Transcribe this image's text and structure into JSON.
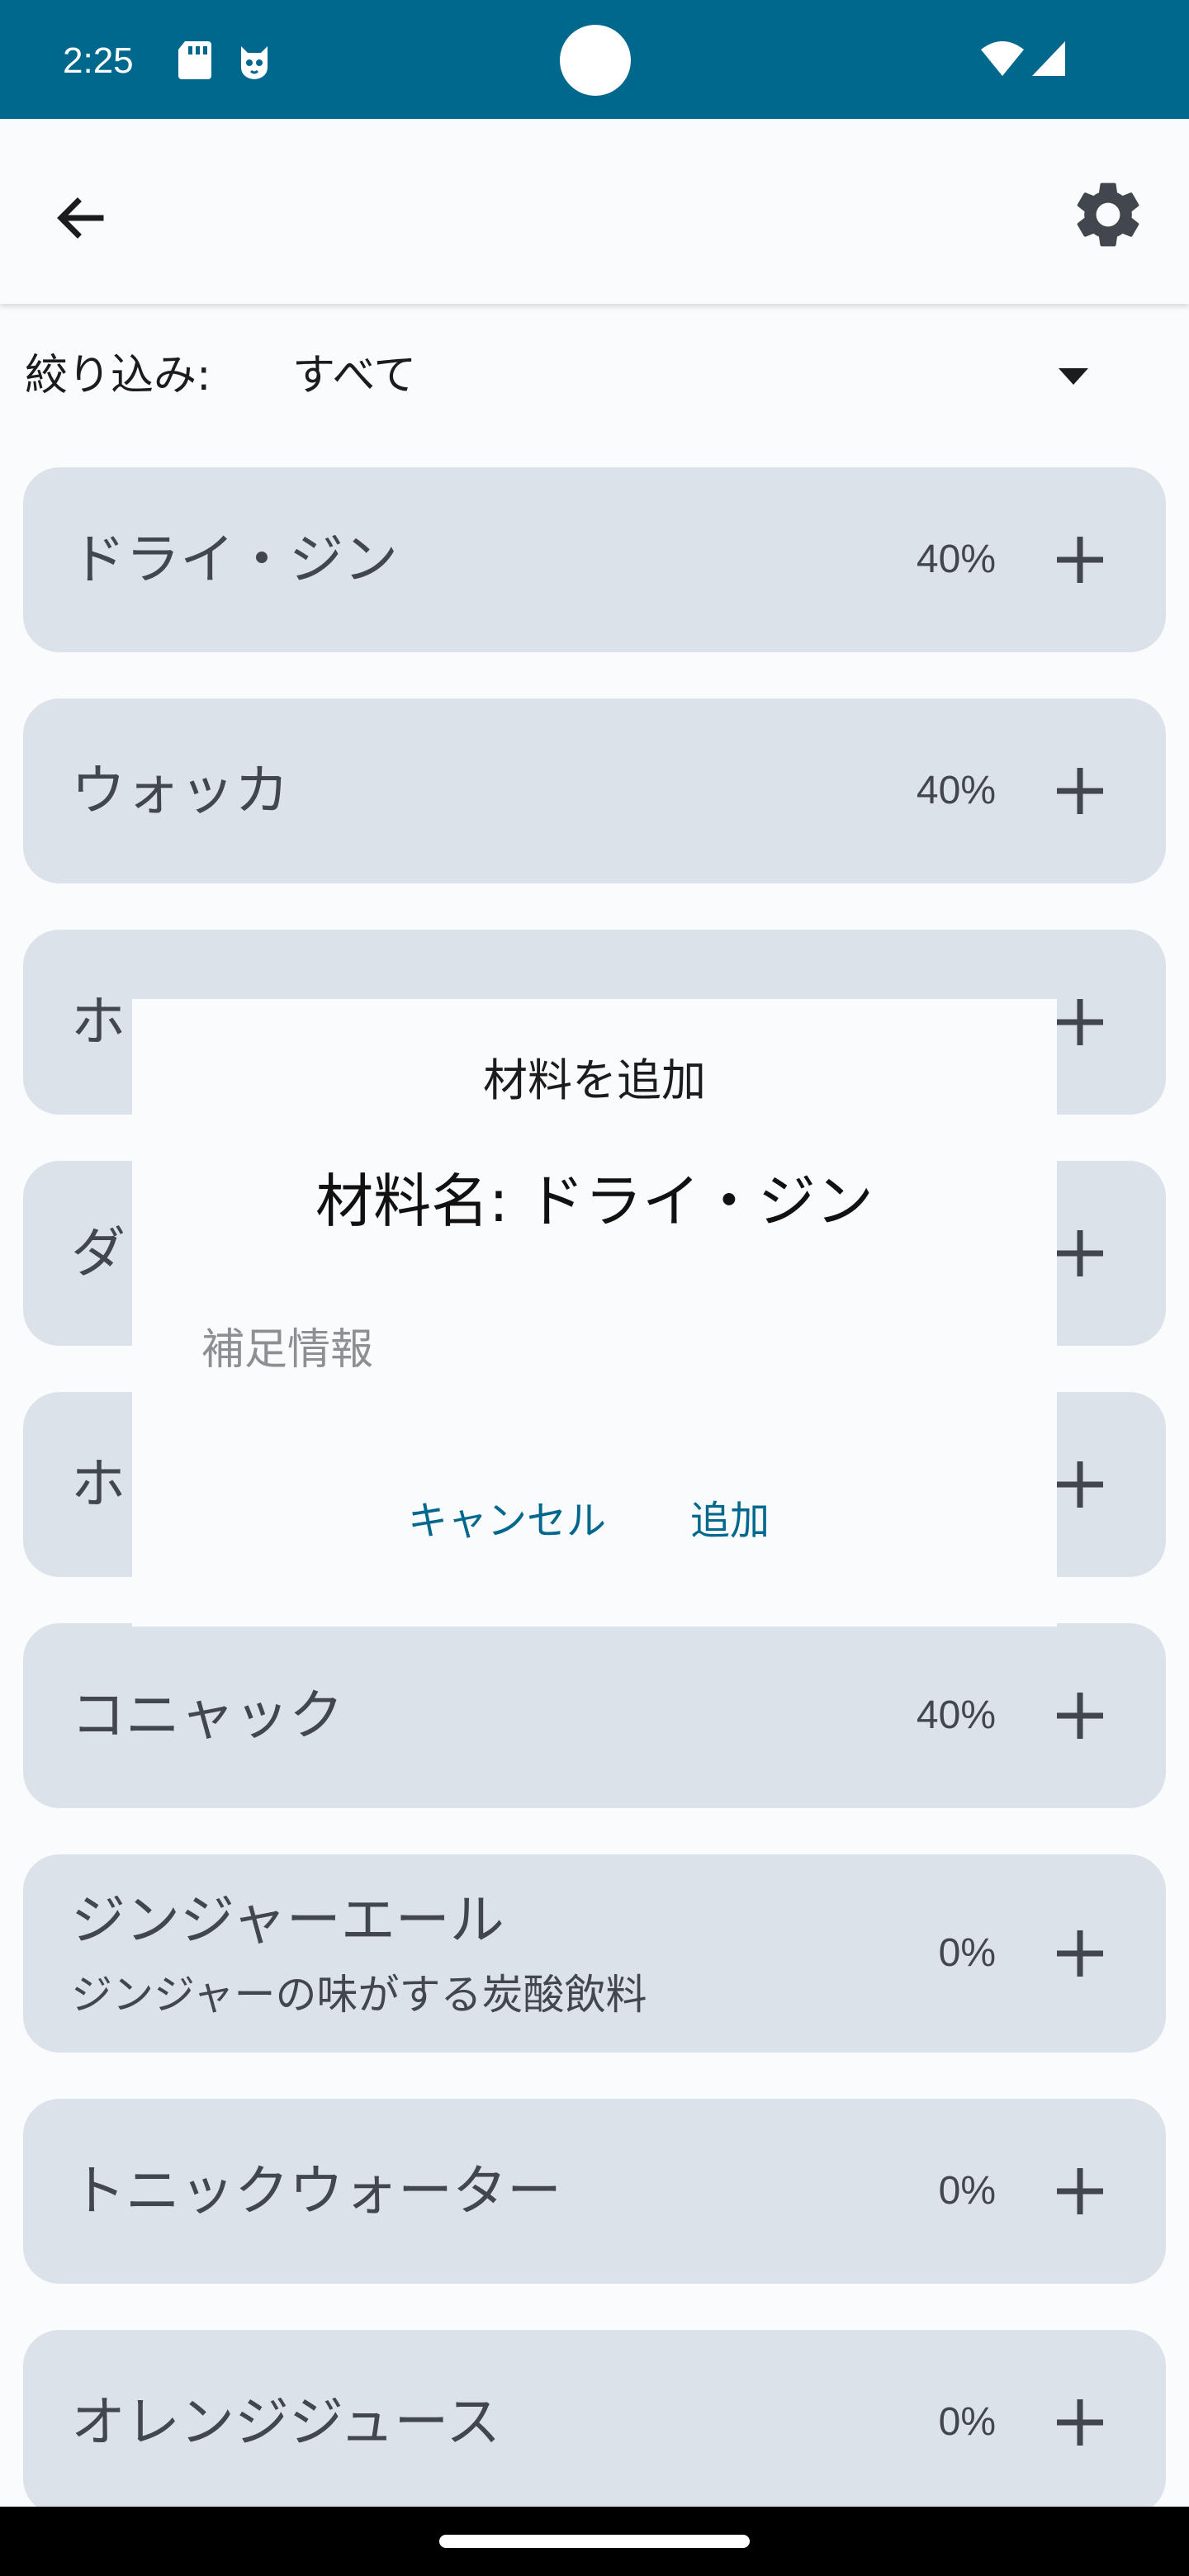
{
  "status_bar": {
    "time": "2:25",
    "icons": [
      "sd-card-icon",
      "cat-notification-icon",
      "wifi-icon",
      "cell-signal-icon"
    ],
    "background": "#00678d"
  },
  "app_bar": {
    "back_icon": "arrow-back-icon",
    "settings_icon": "gear-icon"
  },
  "filter": {
    "label": "絞り込み:",
    "value": "すべて"
  },
  "ingredients": [
    {
      "name": "ドライ・ジン",
      "subtitle": "",
      "abv": "40%"
    },
    {
      "name": "ウォッカ",
      "subtitle": "",
      "abv": "40%"
    },
    {
      "name": "ホ",
      "subtitle": "",
      "abv": ""
    },
    {
      "name": "ダ",
      "subtitle": "",
      "abv": ""
    },
    {
      "name": "ホ",
      "subtitle": "",
      "abv": ""
    },
    {
      "name": "コニャック",
      "subtitle": "",
      "abv": "40%"
    },
    {
      "name": "ジンジャーエール",
      "subtitle": "ジンジャーの味がする炭酸飲料",
      "abv": "0%"
    },
    {
      "name": "トニックウォーター",
      "subtitle": "",
      "abv": "0%"
    },
    {
      "name": "オレンジジュース",
      "subtitle": "",
      "abv": "0%"
    }
  ],
  "dialog": {
    "title": "材料を追加",
    "ingredient_name": "材料名: ドライ・ジン",
    "note_placeholder": "補足情報",
    "note_value": "",
    "cancel_label": "キャンセル",
    "add_label": "追加"
  },
  "colors": {
    "accent": "#00678d",
    "card": "#dce2e9",
    "card_text": "#41474d",
    "background": "#fafbfd"
  }
}
